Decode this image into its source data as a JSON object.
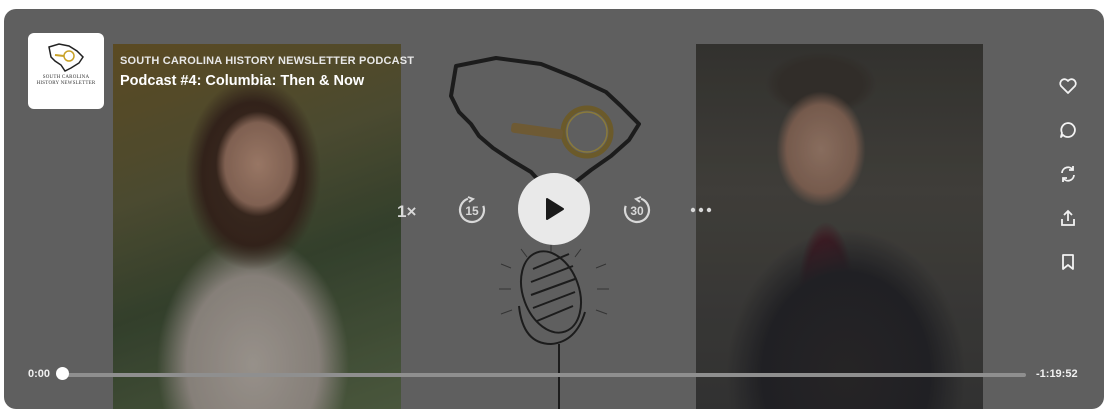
{
  "podcast": {
    "name": "SOUTH CAROLINA HISTORY NEWSLETTER PODCAST",
    "episode_title": "Podcast #4: Columbia: Then & Now",
    "logo_text_line1": "SOUTH CAROLINA",
    "logo_text_line2": "HISTORY NEWSLETTER"
  },
  "controls": {
    "speed_label": "1×",
    "skip_back_seconds": "15",
    "skip_forward_seconds": "30",
    "play_icon": "play-icon",
    "more_icon": "more-horizontal-icon"
  },
  "side_actions": [
    {
      "icon": "heart-icon"
    },
    {
      "icon": "comment-icon"
    },
    {
      "icon": "repost-icon"
    },
    {
      "icon": "share-icon"
    },
    {
      "icon": "bookmark-icon"
    }
  ],
  "progress": {
    "current_time": "0:00",
    "remaining_time": "-1:19:52",
    "fraction": 0
  },
  "colors": {
    "overlay": "#5f5f5f",
    "play_button": "#e9e9e9",
    "track": "#8f8f8f",
    "knob": "#ffffff"
  }
}
